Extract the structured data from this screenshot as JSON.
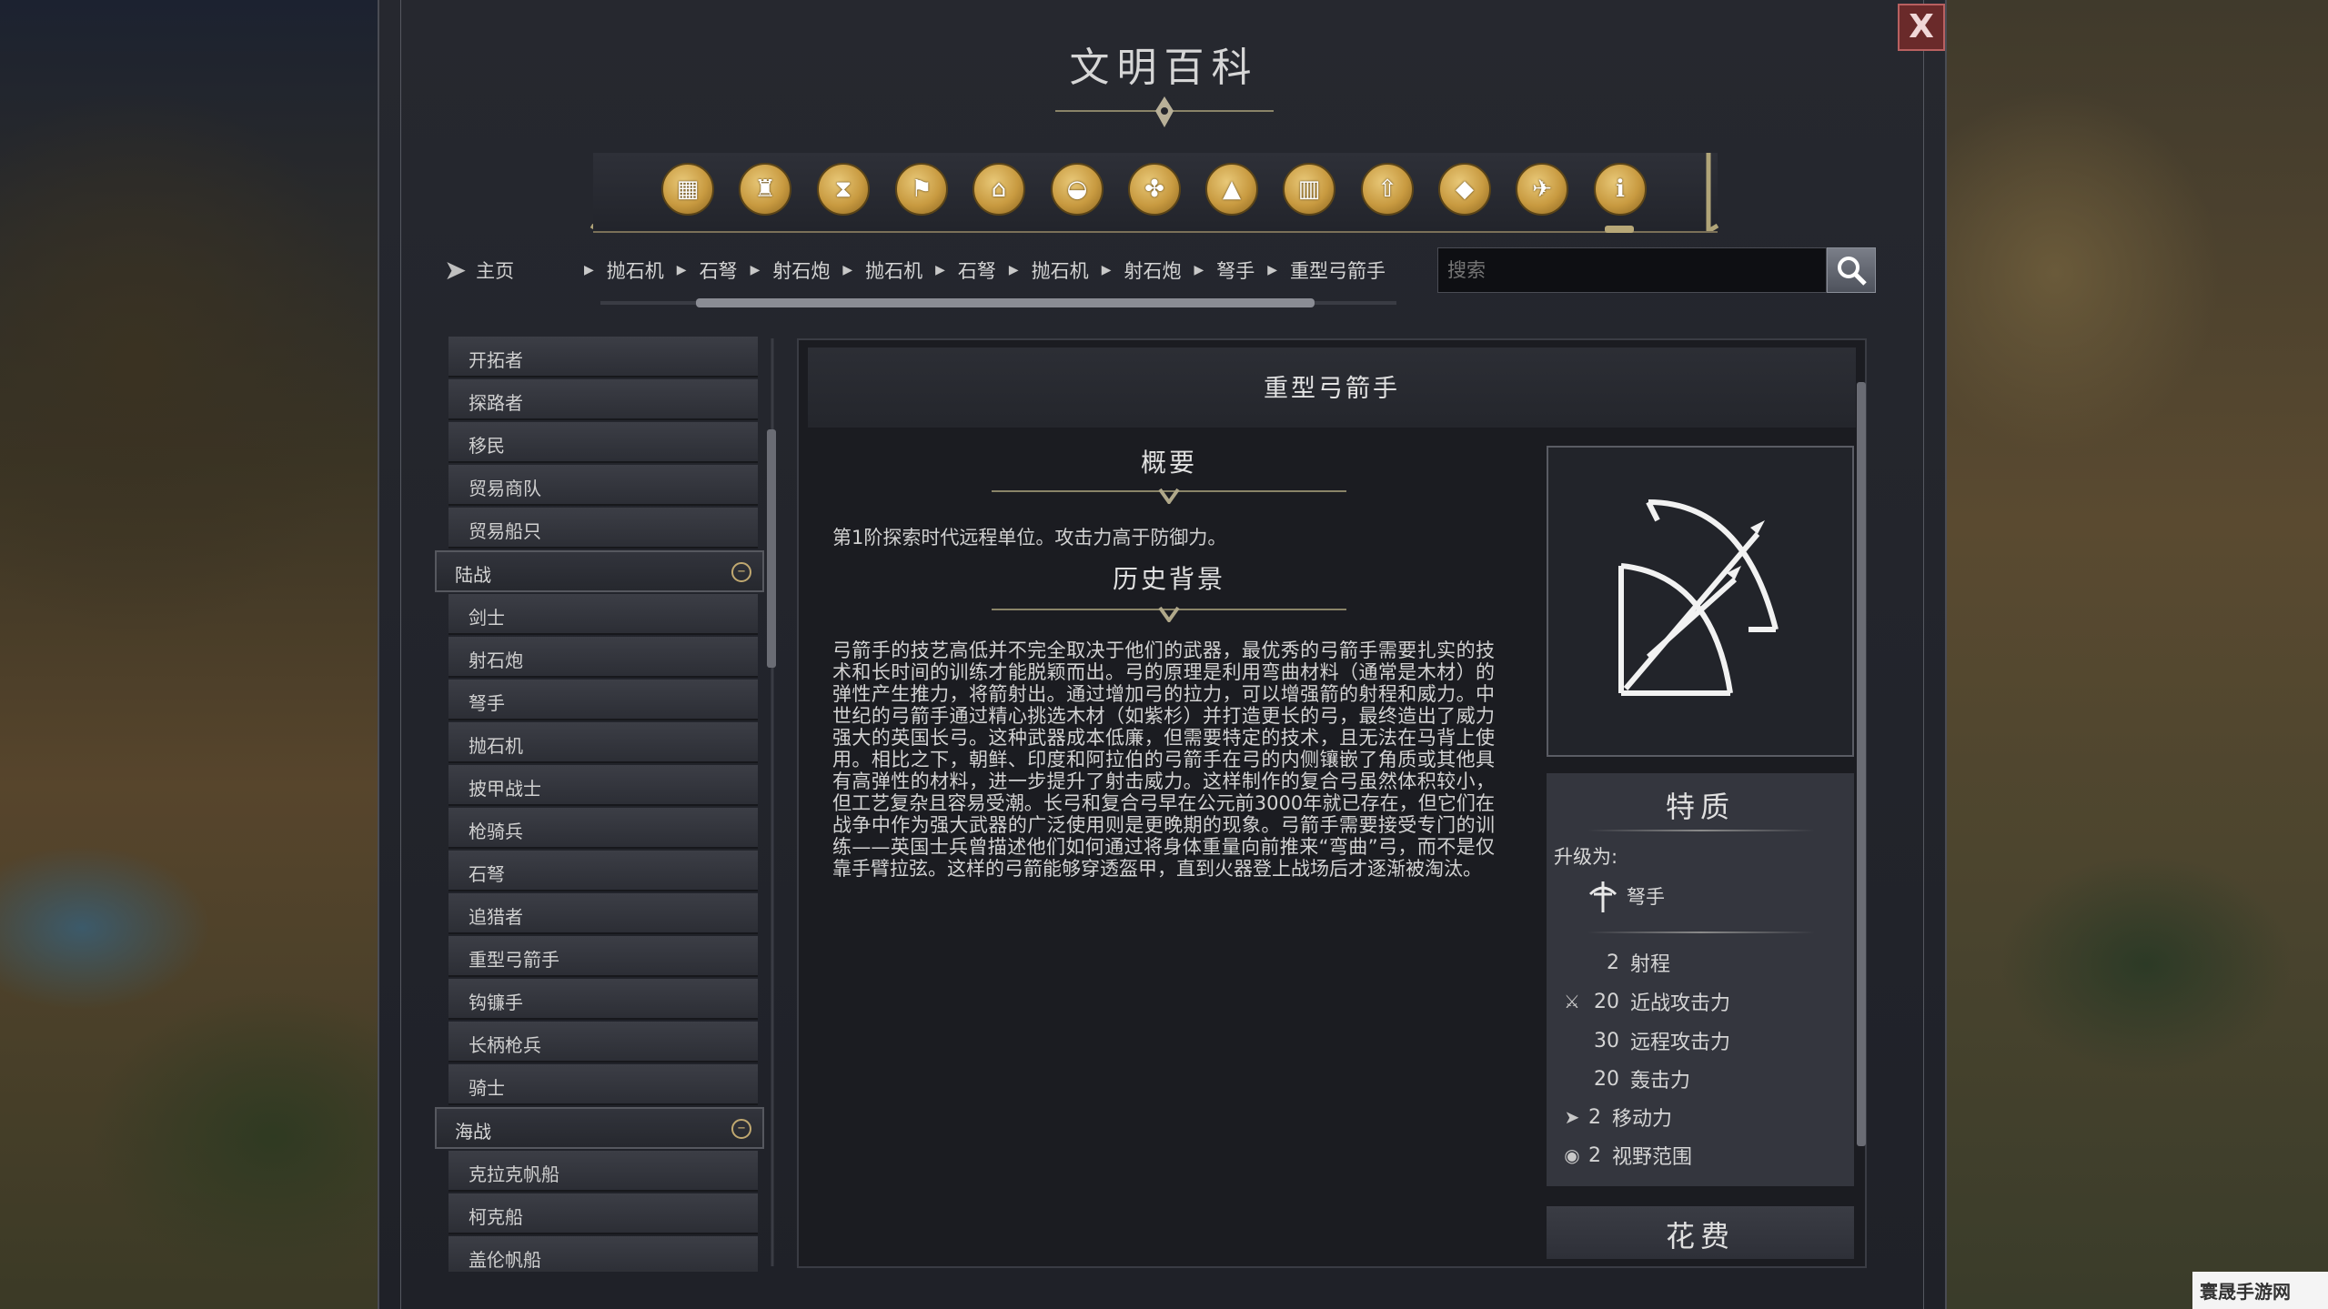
{
  "window": {
    "title": "文明百科",
    "close_label": "X"
  },
  "toolbar": {
    "icons": [
      "resources-icon",
      "wonder-icon",
      "era-hourglass-icon",
      "leader-flag-icon",
      "civics-building-icon",
      "government-icon",
      "diplomacy-icon",
      "terrain-mountain-icon",
      "city-building-icon",
      "upgrade-arrow-icon",
      "book-icon",
      "bird-icon",
      "info-icon"
    ]
  },
  "nav": {
    "home_label": "主页",
    "breadcrumbs": [
      "抛石机",
      "石弩",
      "射石炮",
      "抛石机",
      "石弩",
      "抛石机",
      "射石炮",
      "弩手",
      "重型弓箭手"
    ],
    "search_placeholder": "搜索"
  },
  "sidebar": {
    "top_items": [
      "开拓者",
      "探路者",
      "移民",
      "贸易商队",
      "贸易船只"
    ],
    "land_category": "陆战",
    "land_items": [
      "剑士",
      "射石炮",
      "弩手",
      "抛石机",
      "披甲战士",
      "枪骑兵",
      "石弩",
      "追猎者",
      "重型弓箭手",
      "钩镰手",
      "长柄枪兵",
      "骑士"
    ],
    "naval_category": "海战",
    "naval_items": [
      "克拉克帆船",
      "柯克船",
      "盖伦帆船"
    ]
  },
  "article": {
    "title": "重型弓箭手",
    "summary_heading": "概要",
    "summary_text": "第1阶探索时代远程单位。攻击力高于防御力。",
    "history_heading": "历史背景",
    "history_text": "弓箭手的技艺高低并不完全取决于他们的武器，最优秀的弓箭手需要扎实的技术和长时间的训练才能脱颖而出。弓的原理是利用弯曲材料（通常是木材）的弹性产生推力，将箭射出。通过增加弓的拉力，可以增强箭的射程和威力。中世纪的弓箭手通过精心挑选木材（如紫杉）并打造更长的弓，最终造出了威力强大的英国长弓。这种武器成本低廉，但需要特定的技术，且无法在马背上使用。相比之下，朝鲜、印度和阿拉伯的弓箭手在弓的内侧镶嵌了角质或其他具有高弹性的材料，进一步提升了射击威力。这样制作的复合弓虽然体积较小，但工艺复杂且容易受潮。长弓和复合弓早在公元前3000年就已存在，但它们在战争中作为强大武器的广泛使用则是更晚期的现象。弓箭手需要接受专门的训练——英国士兵曾描述他们如何通过将身体重量向前推来“弯曲”弓，而不是仅靠手臂拉弦。这样的弓箭能够穿透盔甲，直到火器登上战场后才逐渐被淘汰。"
  },
  "traits": {
    "heading": "特质",
    "upgrade_label": "升级为:",
    "upgrade_target": "弩手",
    "stats": [
      {
        "icon": "",
        "value": "2",
        "label": "射程"
      },
      {
        "icon": "sword-icon",
        "value": "20",
        "label": "近战攻击力"
      },
      {
        "icon": "",
        "value": "30",
        "label": "远程攻击力"
      },
      {
        "icon": "",
        "value": "20",
        "label": "轰击力"
      },
      {
        "icon": "movement-arrow-icon",
        "value": "2",
        "label": "移动力"
      },
      {
        "icon": "eye-icon",
        "value": "2",
        "label": "视野范围"
      }
    ]
  },
  "cost": {
    "heading": "花费"
  },
  "watermark": {
    "text": "寰晟手游网"
  }
}
